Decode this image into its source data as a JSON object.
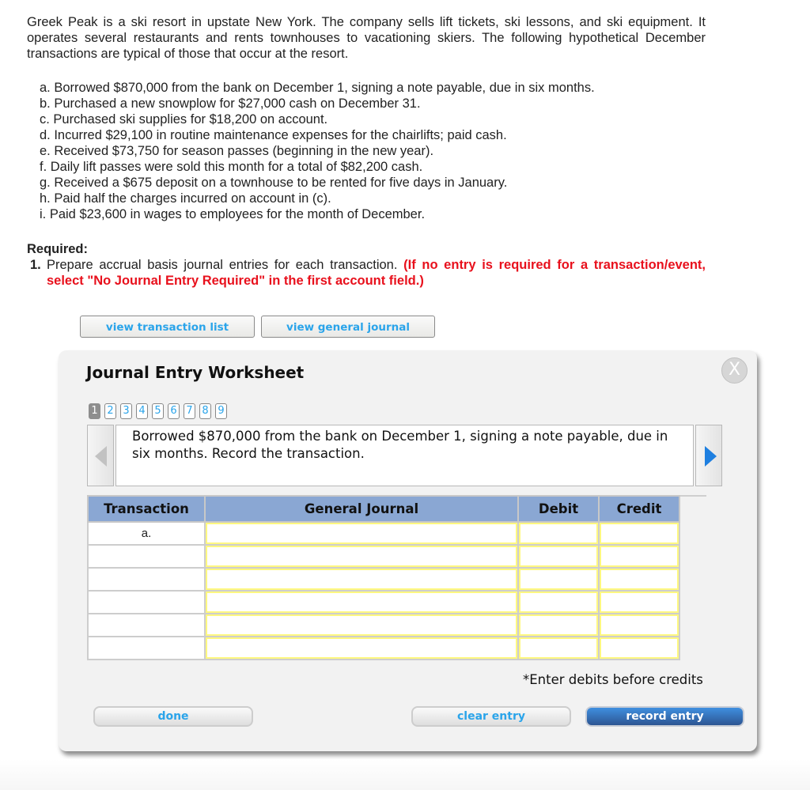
{
  "problem": {
    "intro": "Greek Peak is a ski resort in upstate New York. The company sells lift tickets, ski lessons, and ski equipment. It operates several restaurants and rents townhouses to vacationing skiers. The following hypothetical December transactions are typical of those that occur at the resort.",
    "transactions": [
      "a. Borrowed $870,000 from the bank on December 1, signing a note payable, due in six months.",
      "b. Purchased a new snowplow for $27,000 cash on December 31.",
      "c. Purchased ski supplies for $18,200 on account.",
      "d. Incurred $29,100 in routine maintenance expenses for the chairlifts; paid cash.",
      "e. Received $73,750 for season passes (beginning in the new year).",
      "f. Daily lift passes were sold this month for a total of $82,200 cash.",
      "g. Received a $675 deposit on a townhouse to be rented for five days in January.",
      "h. Paid half the charges incurred on account in (c).",
      "i. Paid $23,600 in wages to employees for the month of December."
    ],
    "required_label": "Required:",
    "required_number": "1.",
    "required_text": "Prepare accrual basis journal entries for each transaction.",
    "required_note": "(If no entry is required for a transaction/event, select \"No Journal Entry Required\" in the first account field.)"
  },
  "top_buttons": {
    "view_transaction_list": "view transaction list",
    "view_general_journal": "view general journal"
  },
  "worksheet": {
    "title": "Journal Entry Worksheet",
    "close_label": "X",
    "pages": [
      "1",
      "2",
      "3",
      "4",
      "5",
      "6",
      "7",
      "8",
      "9"
    ],
    "active_page": "1",
    "prompt": "Borrowed $870,000 from the bank on December 1, signing a note payable, due in six months. Record the transaction.",
    "table": {
      "headers": [
        "Transaction",
        "General Journal",
        "Debit",
        "Credit"
      ],
      "rows": [
        {
          "transaction": "a.",
          "account": "",
          "debit": "",
          "credit": ""
        },
        {
          "transaction": "",
          "account": "",
          "debit": "",
          "credit": ""
        },
        {
          "transaction": "",
          "account": "",
          "debit": "",
          "credit": ""
        },
        {
          "transaction": "",
          "account": "",
          "debit": "",
          "credit": ""
        },
        {
          "transaction": "",
          "account": "",
          "debit": "",
          "credit": ""
        },
        {
          "transaction": "",
          "account": "",
          "debit": "",
          "credit": ""
        }
      ]
    },
    "note": "*Enter debits before credits",
    "buttons": {
      "done": "done",
      "clear_entry": "clear entry",
      "record_entry": "record entry"
    },
    "icons": {
      "prev": "triangle-left-icon",
      "next": "triangle-right-icon",
      "close": "close-circle-icon"
    }
  }
}
